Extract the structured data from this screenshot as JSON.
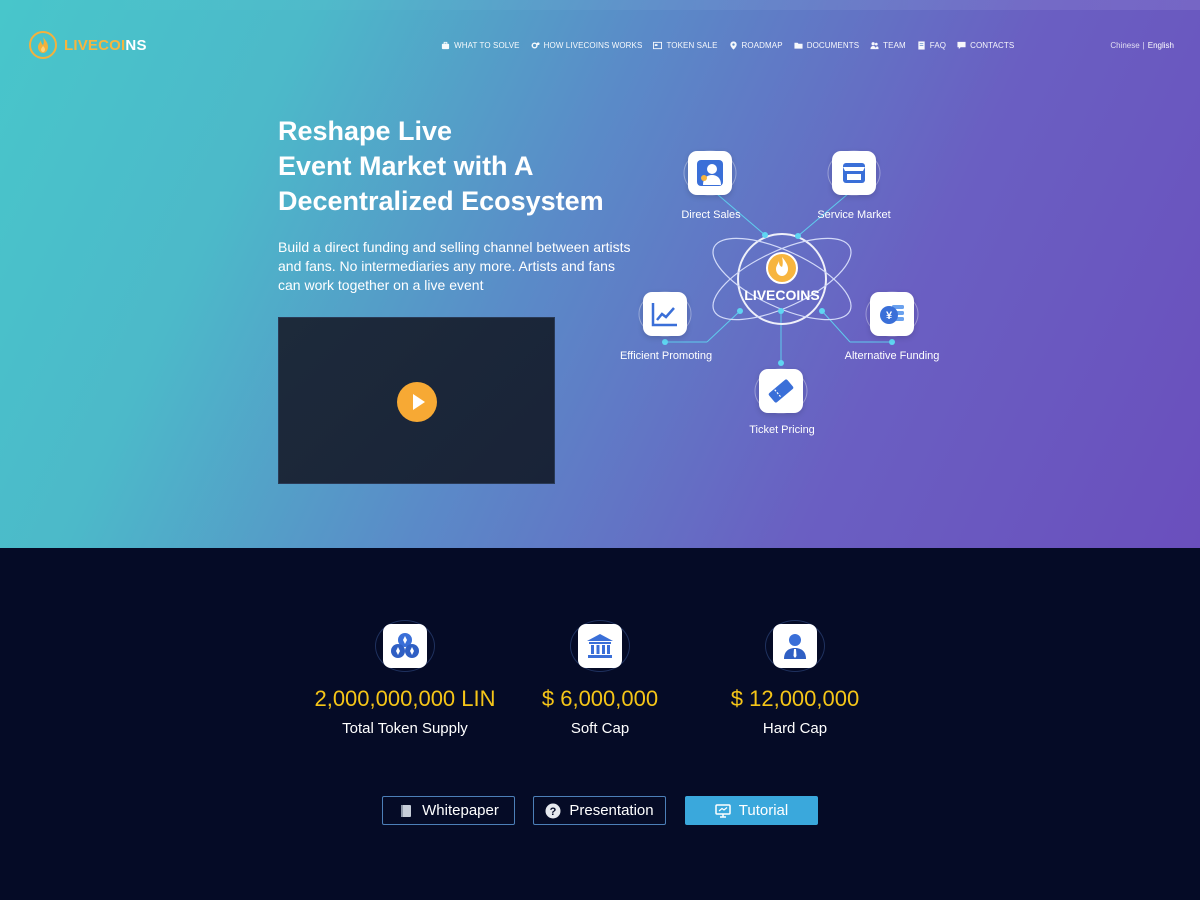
{
  "brand": {
    "name_part1": "LIVECOI",
    "name_part2": "NS",
    "accent": "#f7b53f"
  },
  "nav": {
    "items": [
      {
        "label": "WHAT TO SOLVE",
        "icon": "briefcase-icon"
      },
      {
        "label": "HOW LIVECOINS WORKS",
        "icon": "gears-icon"
      },
      {
        "label": "TOKEN SALE",
        "icon": "id-card-icon"
      },
      {
        "label": "ROADMAP",
        "icon": "map-pin-icon"
      },
      {
        "label": "DOCUMENTS",
        "icon": "folder-icon"
      },
      {
        "label": "TEAM",
        "icon": "users-icon"
      },
      {
        "label": "FAQ",
        "icon": "book-icon"
      },
      {
        "label": "CONTACTS",
        "icon": "chat-icon"
      }
    ],
    "lang": {
      "chinese": "Chinese",
      "separator": "|",
      "english": "English"
    }
  },
  "hero": {
    "headline": [
      "Reshape Live",
      "Event Market with A",
      "Decentralized Ecosystem"
    ],
    "lead": [
      "Build a direct funding and selling channel between artists",
      "and fans. No intermediaries any more. Artists and fans",
      "can work together on a live event"
    ]
  },
  "diagram": {
    "center": "LIVECOINS",
    "nodes": [
      {
        "label": "Direct Sales",
        "icon": "salesperson-icon"
      },
      {
        "label": "Service Market",
        "icon": "storefront-icon"
      },
      {
        "label": "Efficient Promoting",
        "icon": "line-chart-icon"
      },
      {
        "label": "Alternative Funding",
        "icon": "yen-coins-icon"
      },
      {
        "label": "Ticket Pricing",
        "icon": "ticket-icon"
      }
    ]
  },
  "stats": [
    {
      "value": "2,000,000,000 LIN",
      "label": "Total Token Supply",
      "icon": "token-cluster-icon"
    },
    {
      "value": "$ 6,000,000",
      "label": "Soft Cap",
      "icon": "bank-icon"
    },
    {
      "value": "$ 12,000,000",
      "label": "Hard Cap",
      "icon": "person-icon"
    }
  ],
  "buttons": {
    "whitepaper": "Whitepaper",
    "presentation": "Presentation",
    "tutorial": "Tutorial"
  },
  "colors": {
    "hero_start": "#48c6cb",
    "hero_end": "#6a4fbd",
    "dark_bg": "#050b26",
    "stat_value": "#f5c518",
    "primary_button": "#3aa8dc"
  }
}
